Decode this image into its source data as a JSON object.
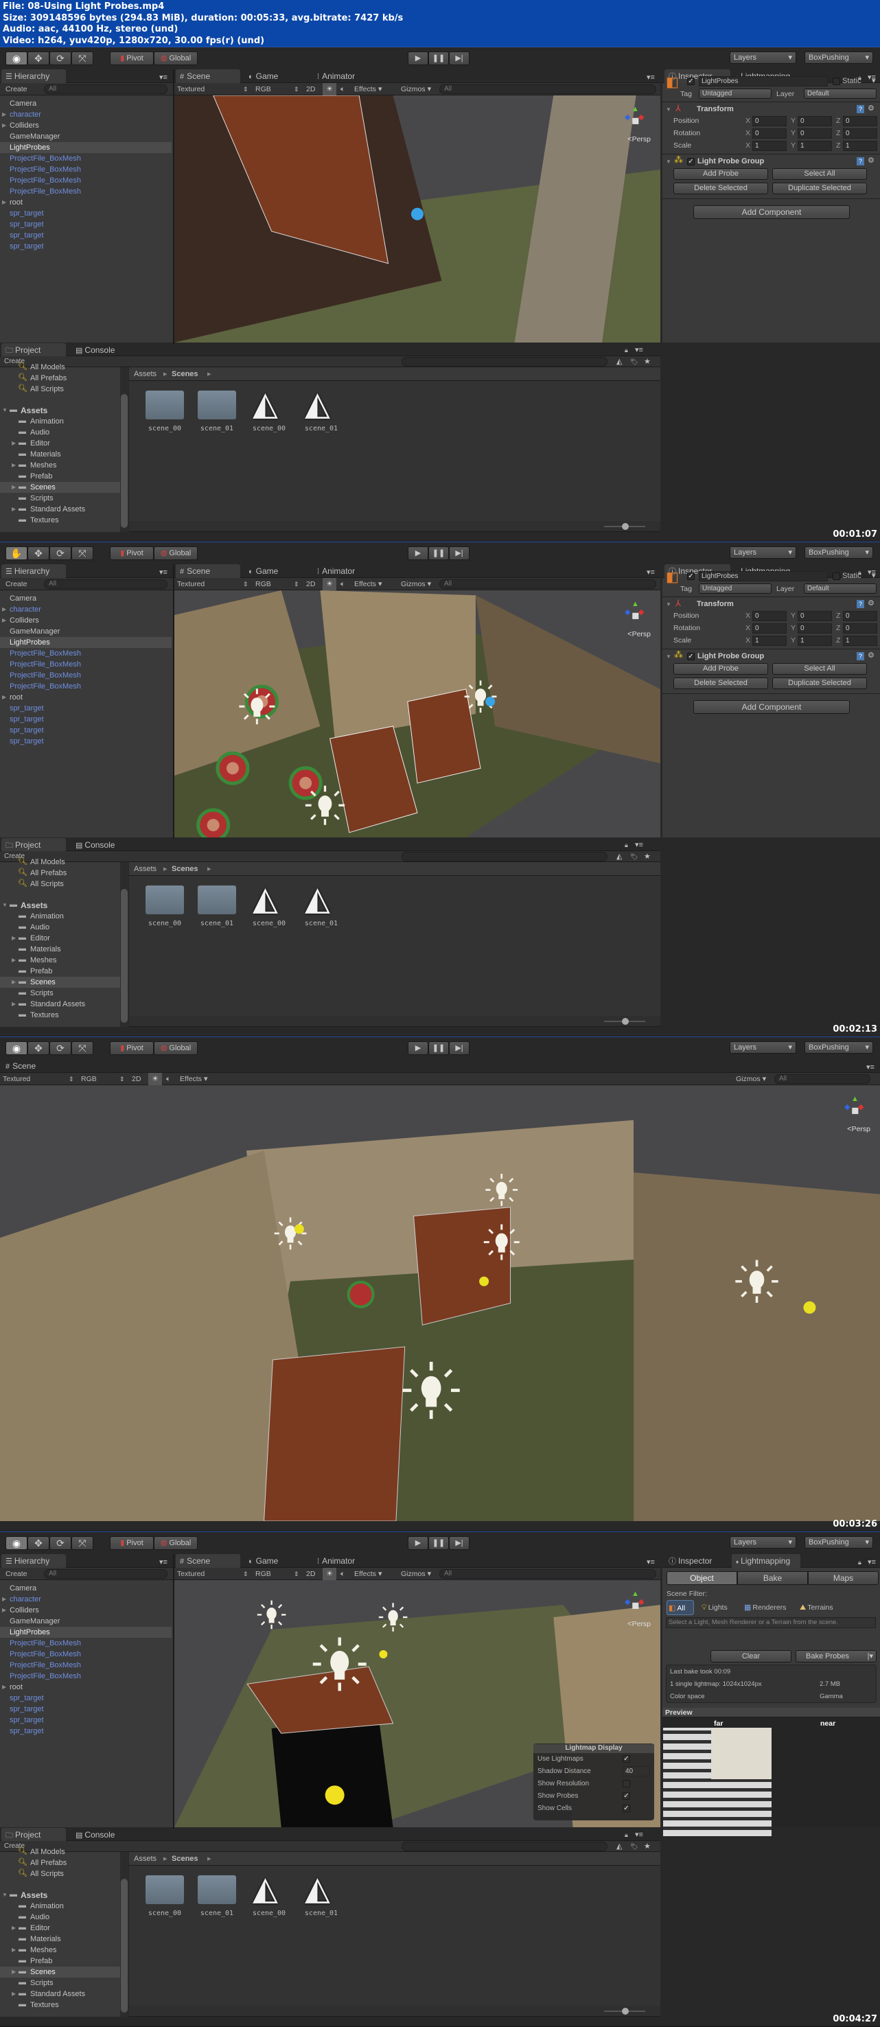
{
  "header": {
    "file": "File: 08-Using Light Probes.mp4",
    "size": "Size: 309148596 bytes (294.83 MiB), duration: 00:05:33, avg.bitrate: 7427 kb/s",
    "audio": "Audio: aac, 44100 Hz, stereo (und)",
    "video": "Video: h264, yuv420p, 1280x720, 30.00 fps(r) (und)"
  },
  "frames": [
    {
      "timestamp": "00:01:07",
      "active_tool": "view",
      "layout": "split",
      "inspector_tab": "Inspector"
    },
    {
      "timestamp": "00:02:13",
      "active_tool": "hand",
      "layout": "split",
      "inspector_tab": "Inspector"
    },
    {
      "timestamp": "00:03:26",
      "active_tool": "view",
      "layout": "scene-maximized",
      "inspector_tab": ""
    },
    {
      "timestamp": "00:04:27",
      "active_tool": "view",
      "layout": "split",
      "inspector_tab": "Lightmapping"
    }
  ],
  "toolbar": {
    "pivot": "Pivot",
    "global": "Global",
    "layers": "Layers",
    "layout": "BoxPushing"
  },
  "hierarchy": {
    "tab": "Hierarchy",
    "create": "Create",
    "search": "All",
    "items": [
      {
        "label": "Camera",
        "prefab": false,
        "expandable": false,
        "selected": false
      },
      {
        "label": "character",
        "prefab": true,
        "expandable": true,
        "selected": false
      },
      {
        "label": "Colliders",
        "prefab": false,
        "expandable": true,
        "selected": false
      },
      {
        "label": "GameManager",
        "prefab": false,
        "expandable": false,
        "selected": false
      },
      {
        "label": "LightProbes",
        "prefab": false,
        "expandable": false,
        "selected": true
      },
      {
        "label": "ProjectFile_BoxMesh",
        "prefab": true,
        "expandable": false,
        "selected": false
      },
      {
        "label": "ProjectFile_BoxMesh",
        "prefab": true,
        "expandable": false,
        "selected": false
      },
      {
        "label": "ProjectFile_BoxMesh",
        "prefab": true,
        "expandable": false,
        "selected": false
      },
      {
        "label": "ProjectFile_BoxMesh",
        "prefab": true,
        "expandable": false,
        "selected": false
      },
      {
        "label": "root",
        "prefab": false,
        "expandable": true,
        "selected": false
      },
      {
        "label": "spr_target",
        "prefab": true,
        "expandable": false,
        "selected": false
      },
      {
        "label": "spr_target",
        "prefab": true,
        "expandable": false,
        "selected": false
      },
      {
        "label": "spr_target",
        "prefab": true,
        "expandable": false,
        "selected": false
      },
      {
        "label": "spr_target",
        "prefab": true,
        "expandable": false,
        "selected": false
      }
    ]
  },
  "scene": {
    "tabs": [
      "Scene",
      "Game",
      "Animator"
    ],
    "render_mode": "Textured",
    "channel": "RGB",
    "mode_2d": "2D",
    "effects": "Effects",
    "gizmos": "Gizmos",
    "search": "All",
    "persp": "Persp"
  },
  "inspector": {
    "tab_inspector": "Inspector",
    "tab_lightmapping": "Lightmapping",
    "object_name": "LightProbes",
    "active": true,
    "static_label": "Static",
    "tag_label": "Tag",
    "tag_value": "Untagged",
    "layer_label": "Layer",
    "layer_value": "Default",
    "transform": {
      "title": "Transform",
      "rows": [
        {
          "label": "Position",
          "x": "0",
          "y": "0",
          "z": "0"
        },
        {
          "label": "Rotation",
          "x": "0",
          "y": "0",
          "z": "0"
        },
        {
          "label": "Scale",
          "x": "1",
          "y": "1",
          "z": "1"
        }
      ],
      "axis": [
        "X",
        "Y",
        "Z"
      ]
    },
    "light_probe_group": {
      "title": "Light Probe Group",
      "enabled": true,
      "buttons": [
        "Add Probe",
        "Select All",
        "Delete Selected",
        "Duplicate Selected"
      ]
    },
    "add_component": "Add Component"
  },
  "lightmapping": {
    "modes": [
      "Object",
      "Bake",
      "Maps"
    ],
    "active_mode": "Object",
    "scene_filter": "Scene Filter:",
    "filters": [
      "All",
      "Lights",
      "Renderers",
      "Terrains"
    ],
    "hint": "Select a Light, Mesh Renderer or a Terrain from the scene.",
    "clear": "Clear",
    "bake": "Bake Probes",
    "info": [
      {
        "label": "Last bake took 00:09",
        "value": ""
      },
      {
        "label": "1 single lightmap: 1024x1024px",
        "value": "2.7 MB"
      },
      {
        "label": "Color space",
        "value": "Gamma"
      }
    ],
    "preview": "Preview",
    "far": "far",
    "near": "near"
  },
  "lightmap_display": {
    "title": "Lightmap Display",
    "options": [
      {
        "label": "Use Lightmaps",
        "type": "check",
        "value": true
      },
      {
        "label": "Shadow Distance",
        "type": "number",
        "value": "40"
      },
      {
        "label": "Show Resolution",
        "type": "check",
        "value": false
      },
      {
        "label": "Show Probes",
        "type": "check",
        "value": true
      },
      {
        "label": "Show Cells",
        "type": "check",
        "value": true
      }
    ]
  },
  "project": {
    "tab": "Project",
    "console_tab": "Console",
    "create": "Create",
    "favorites": [
      "All Models",
      "All Prefabs",
      "All Scripts"
    ],
    "root": "Assets",
    "folders": [
      {
        "label": "Animation",
        "expandable": false,
        "selected": false
      },
      {
        "label": "Audio",
        "expandable": false,
        "selected": false
      },
      {
        "label": "Editor",
        "expandable": true,
        "selected": false
      },
      {
        "label": "Materials",
        "expandable": false,
        "selected": false
      },
      {
        "label": "Meshes",
        "expandable": true,
        "selected": false
      },
      {
        "label": "Prefab",
        "expandable": false,
        "selected": false
      },
      {
        "label": "Scenes",
        "expandable": true,
        "selected": true
      },
      {
        "label": "Scripts",
        "expandable": false,
        "selected": false
      },
      {
        "label": "Standard Assets",
        "expandable": true,
        "selected": false
      },
      {
        "label": "Textures",
        "expandable": false,
        "selected": false
      }
    ],
    "breadcrumb": [
      "Assets",
      "Scenes"
    ],
    "files": [
      {
        "label": "scene_00",
        "kind": "folder"
      },
      {
        "label": "scene_01",
        "kind": "folder"
      },
      {
        "label": "scene_00",
        "kind": "unity-scene"
      },
      {
        "label": "scene_01",
        "kind": "unity-scene"
      }
    ]
  },
  "colors": {
    "header_bg": "#0b47a8",
    "prefab_text": "#6f8fe0",
    "panel_bg": "#3a3a3a",
    "frame_border": "#2450a0"
  }
}
